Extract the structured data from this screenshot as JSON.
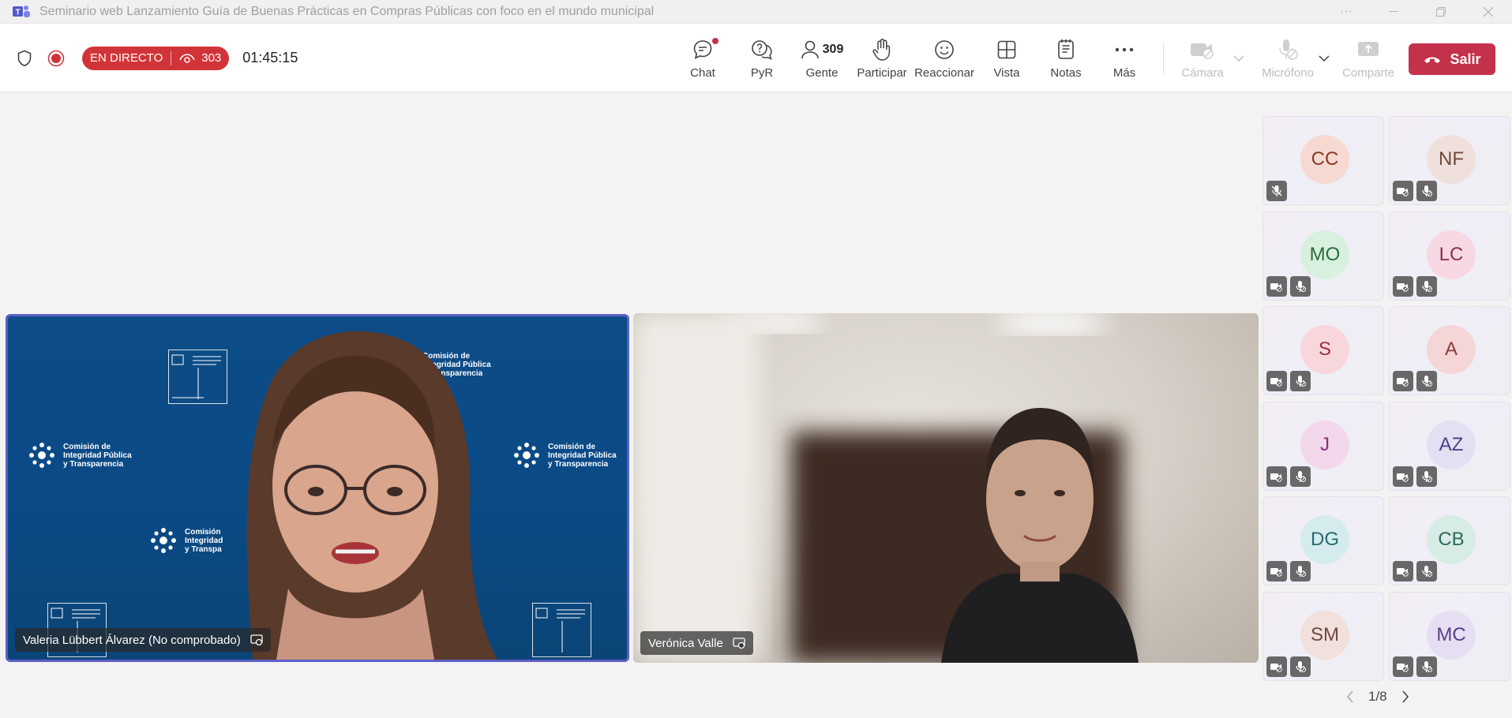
{
  "window": {
    "title": "Seminario web Lanzamiento Guía de Buenas Prácticas en Compras Públicas con foco en el mundo municipal"
  },
  "toolbar": {
    "live_label": "EN DIRECTO",
    "viewers": "303",
    "timer": "01:45:15",
    "chat_label": "Chat",
    "qa_label": "PyR",
    "people_label": "Gente",
    "people_count": "309",
    "raise_label": "Participar",
    "react_label": "Reaccionar",
    "view_label": "Vista",
    "notes_label": "Notas",
    "more_label": "Más",
    "camera_label": "Cámara",
    "mic_label": "Micrófono",
    "share_label": "Comparte",
    "leave_label": "Salir"
  },
  "stage": {
    "tile1": {
      "name": "Valeria Lübbert Álvarez (No comprobado)",
      "brand_line1": "Comisión de",
      "brand_line2": "Integridad Pública",
      "brand_line3": "y Transparencia",
      "brand_short_line1": "Comisión",
      "brand_short_line2": "Integridad",
      "brand_short_line3": "y Transpa"
    },
    "tile2": {
      "name": "Verónica Valle"
    }
  },
  "participants": [
    {
      "initials": "CC",
      "bg": "#f6d9d0",
      "fg": "#8a3a26"
    },
    {
      "initials": "NF",
      "bg": "#efe0dc",
      "fg": "#6e4a3c"
    },
    {
      "initials": "MO",
      "bg": "#d8f0de",
      "fg": "#2b6b3b"
    },
    {
      "initials": "LC",
      "bg": "#f7d8e2",
      "fg": "#8d2f52"
    },
    {
      "initials": "S",
      "bg": "#f8d7dc",
      "fg": "#9a2f3f"
    },
    {
      "initials": "A",
      "bg": "#f4d6d6",
      "fg": "#8e3a3a"
    },
    {
      "initials": "J",
      "bg": "#f3d7ec",
      "fg": "#8a2f78"
    },
    {
      "initials": "AZ",
      "bg": "#e4dff2",
      "fg": "#4d3d86"
    },
    {
      "initials": "DG",
      "bg": "#d5ecee",
      "fg": "#266a72"
    },
    {
      "initials": "CB",
      "bg": "#d8ece6",
      "fg": "#2a6a5a"
    },
    {
      "initials": "SM",
      "bg": "#f1e0db",
      "fg": "#6d4a40"
    },
    {
      "initials": "MC",
      "bg": "#e6def2",
      "fg": "#5a3f86"
    }
  ],
  "pager": {
    "label": "1/8"
  }
}
